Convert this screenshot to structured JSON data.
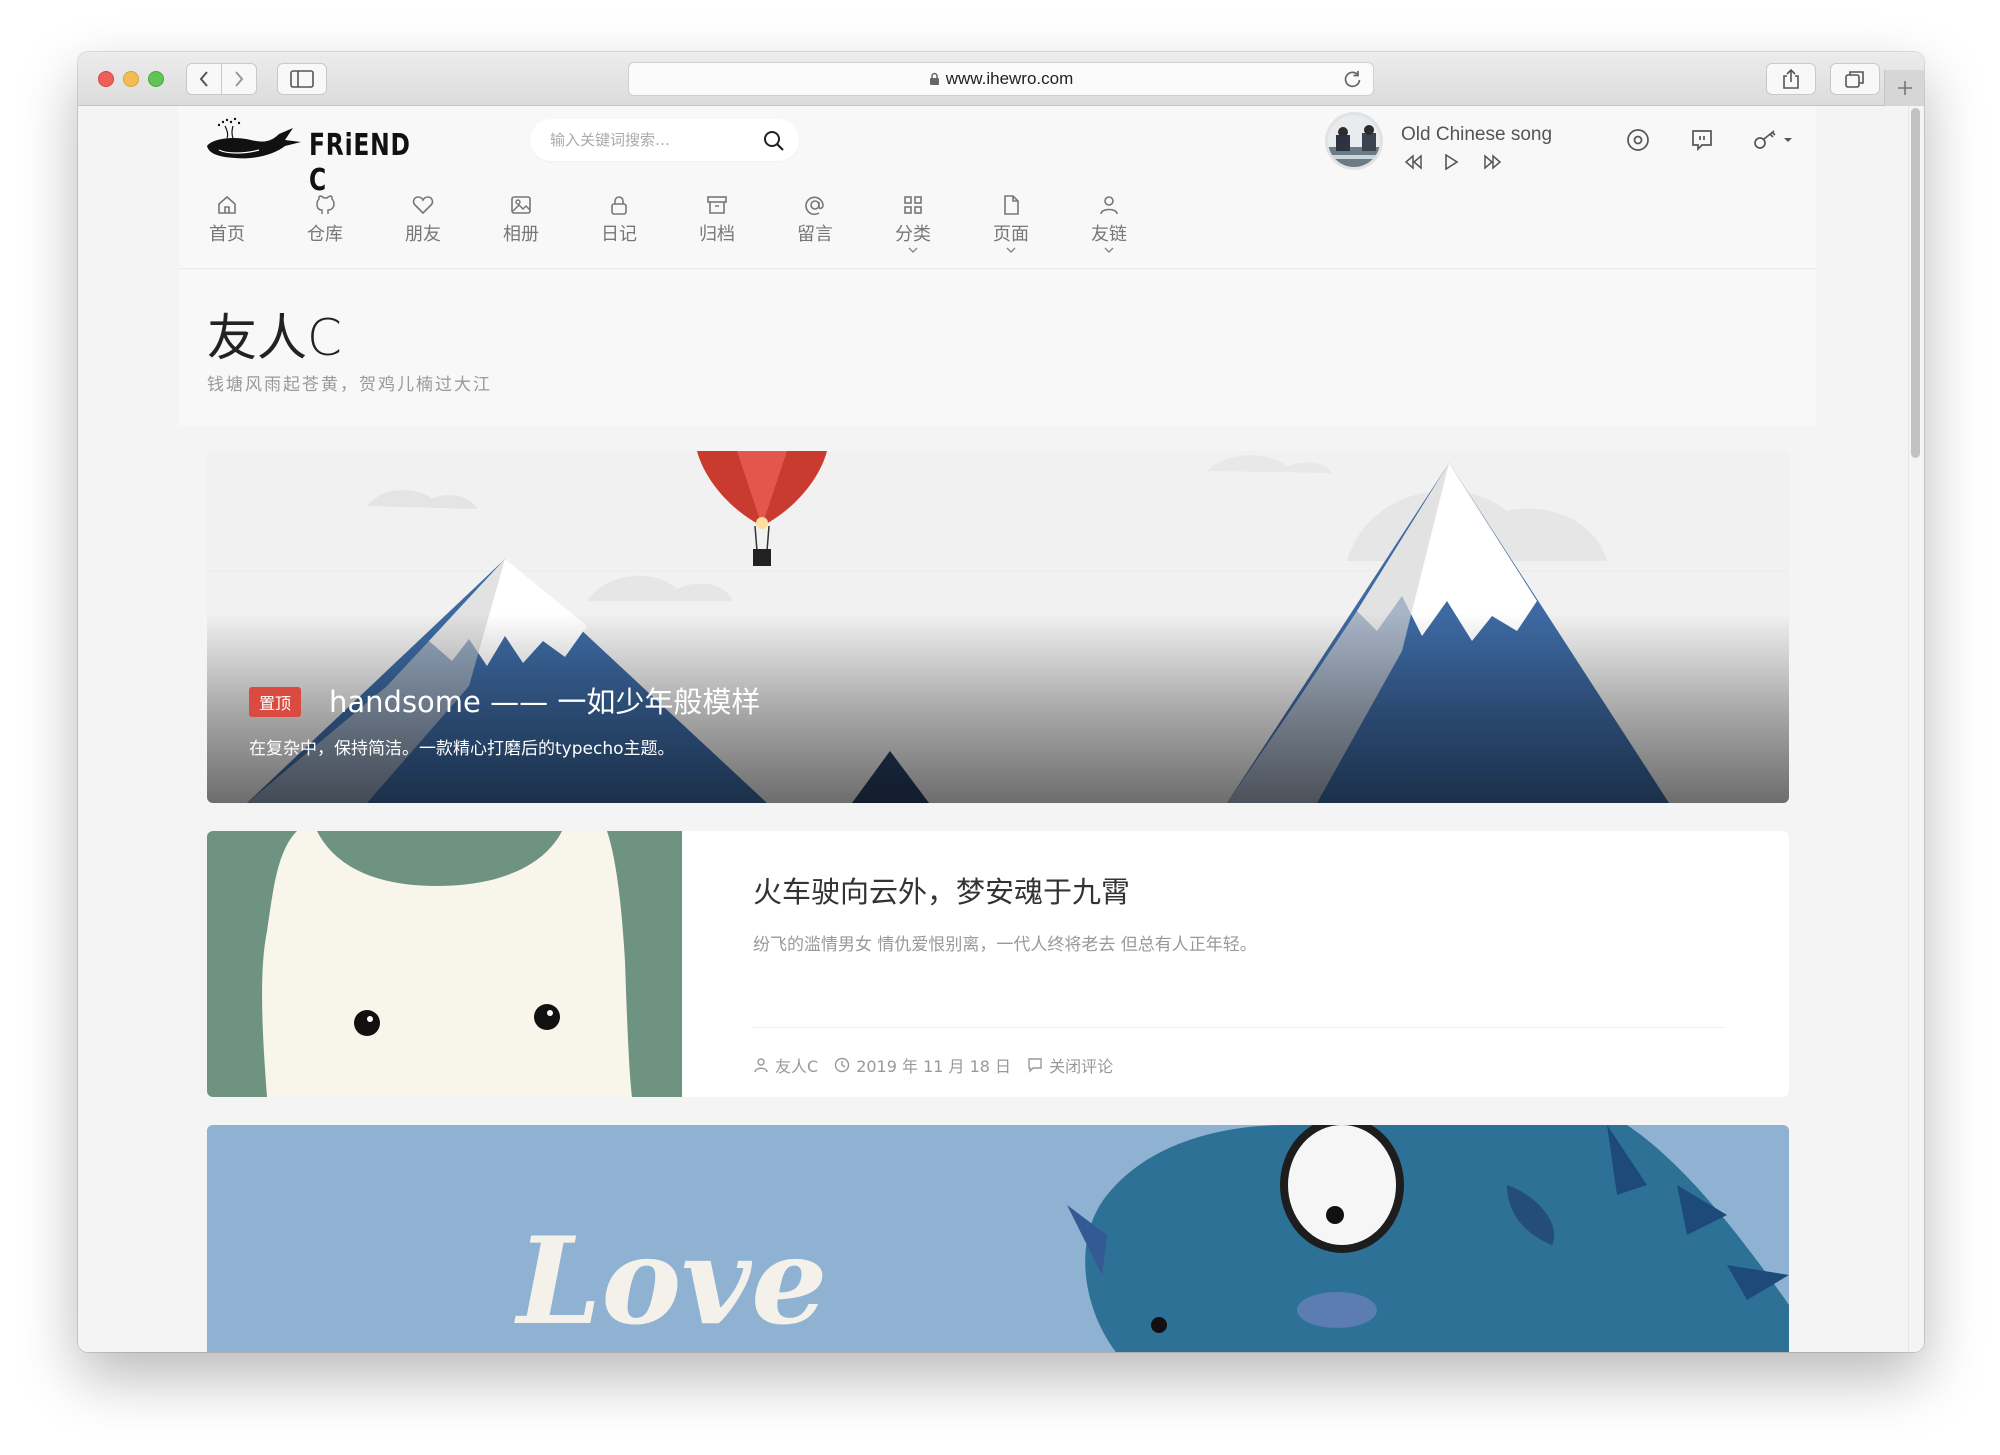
{
  "browser": {
    "url": "www.ihewro.com"
  },
  "header": {
    "logo_text": "FRiEND C",
    "search_placeholder": "输入关键词搜索…",
    "song_title": "Old Chinese song"
  },
  "nav": [
    {
      "label": "首页",
      "icon": "home-icon"
    },
    {
      "label": "仓库",
      "icon": "github-icon"
    },
    {
      "label": "朋友",
      "icon": "heart-icon"
    },
    {
      "label": "相册",
      "icon": "image-icon"
    },
    {
      "label": "日记",
      "icon": "lock-icon"
    },
    {
      "label": "归档",
      "icon": "archive-icon"
    },
    {
      "label": "留言",
      "icon": "at-icon"
    },
    {
      "label": "分类",
      "icon": "grid-icon"
    },
    {
      "label": "页面",
      "icon": "file-icon"
    },
    {
      "label": "友链",
      "icon": "user-icon"
    }
  ],
  "intro": {
    "title": "友人C",
    "subtitle": "钱塘风雨起苍黄，贺鸡儿楠过大江"
  },
  "hero": {
    "badge": "置顶",
    "title": "handsome —— 一如少年般模样",
    "summary": "在复杂中，保持简洁。一款精心打磨后的typecho主题。"
  },
  "post": {
    "title": "火车驶向云外，梦安魂于九霄",
    "summary": "纷飞的滥情男女 情仇爱恨别离，一代人终将老去 但总有人正年轻。",
    "author": "友人C",
    "date": "2019 年 11 月 18 日",
    "comments": "关闭评论"
  },
  "card3": {
    "art_text": "Love"
  },
  "colors": {
    "badge_red": "#d94b40",
    "mountain_blue": "#3a6aa6",
    "card_blue": "#90b2d2",
    "thumb_green": "#6f9381"
  }
}
